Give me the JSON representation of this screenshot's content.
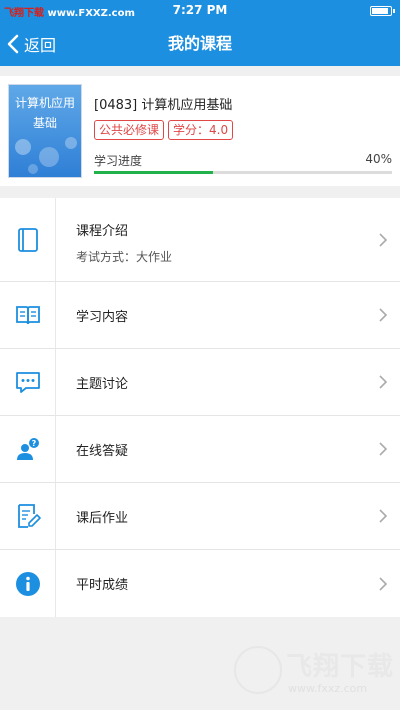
{
  "status_bar": {
    "carrier_prefix": "飞翔下载",
    "carrier_site": "www.FXXZ.com",
    "time": "7:27 PM",
    "battery_level": 0.9
  },
  "nav": {
    "back_label": "返回",
    "title": "我的课程"
  },
  "course": {
    "thumbnail_title": "计算机应用基础",
    "name": "[0483] 计算机应用基础",
    "tags": [
      "公共必修课",
      "学分：4.0"
    ],
    "progress_label": "学习进度",
    "progress_text": "40%",
    "progress": 0.4
  },
  "menu": [
    {
      "label": "课程介绍",
      "sub": "考试方式：大作业",
      "icon": "book-icon"
    },
    {
      "label": "学习内容",
      "icon": "open-book-icon"
    },
    {
      "label": "主题讨论",
      "icon": "chat-icon"
    },
    {
      "label": "在线答疑",
      "icon": "question-user-icon"
    },
    {
      "label": "课后作业",
      "icon": "homework-icon"
    },
    {
      "label": "平时成绩",
      "icon": "info-icon"
    }
  ],
  "watermark": {
    "brand": "飞翔下载",
    "url": "www.fxxz.com"
  },
  "colors": {
    "primary": "#1d8fe0",
    "tag": "#e04848",
    "progress": "#22b24c"
  }
}
